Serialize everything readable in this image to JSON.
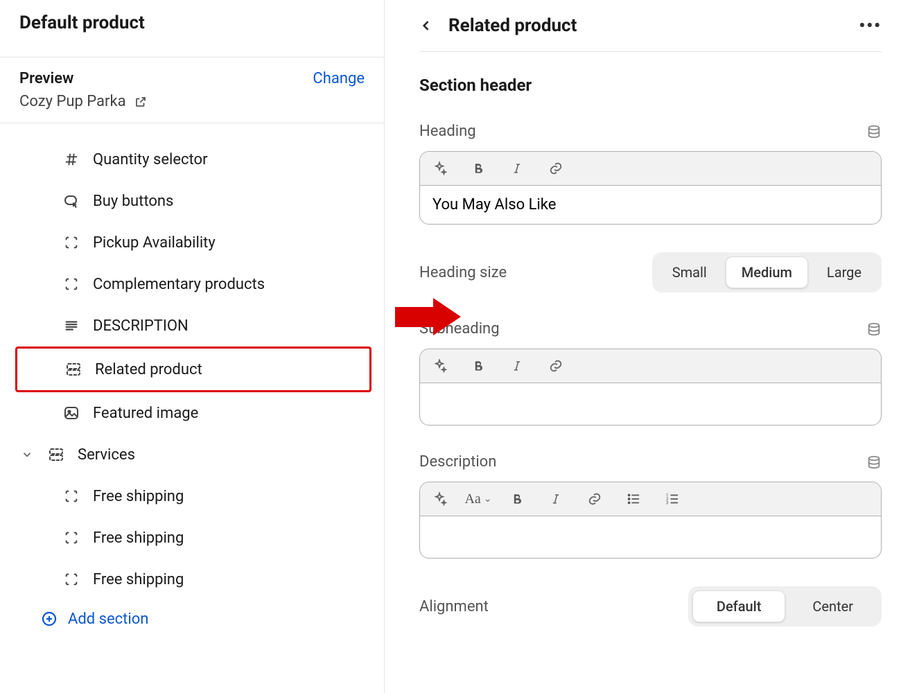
{
  "left": {
    "title": "Default product",
    "preview_label": "Preview",
    "change_label": "Change",
    "product_name": "Cozy Pup Parka",
    "items": [
      {
        "label": "Quantity selector"
      },
      {
        "label": "Buy buttons"
      },
      {
        "label": "Pickup Availability"
      },
      {
        "label": "Complementary products"
      },
      {
        "label": "DESCRIPTION"
      },
      {
        "label": "Related product"
      },
      {
        "label": "Featured image"
      },
      {
        "label": "Services"
      },
      {
        "label": "Free shipping"
      },
      {
        "label": "Free shipping"
      },
      {
        "label": "Free shipping"
      }
    ],
    "add_section_label": "Add section"
  },
  "right": {
    "title": "Related product",
    "section_title": "Section header",
    "heading_label": "Heading",
    "heading_value": "You May Also Like",
    "heading_size_label": "Heading size",
    "heading_size_options": {
      "small": "Small",
      "medium": "Medium",
      "large": "Large"
    },
    "subheading_label": "Subheading",
    "subheading_value": "",
    "description_label": "Description",
    "description_value": "",
    "alignment_label": "Alignment",
    "alignment_options": {
      "default": "Default",
      "center": "Center"
    }
  }
}
